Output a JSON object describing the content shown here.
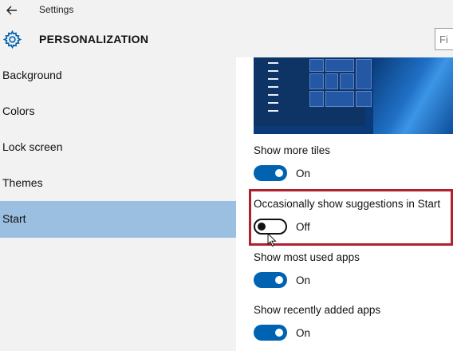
{
  "window": {
    "title": "Settings",
    "back_icon": "back-arrow-icon"
  },
  "header": {
    "title": "PERSONALIZATION",
    "icon": "gear-icon",
    "search_partial": "Fi"
  },
  "sidebar": {
    "items": [
      {
        "label": "Background",
        "selected": false
      },
      {
        "label": "Colors",
        "selected": false
      },
      {
        "label": "Lock screen",
        "selected": false
      },
      {
        "label": "Themes",
        "selected": false
      },
      {
        "label": "Start",
        "selected": true
      }
    ],
    "selected_color": "#9bbfe0"
  },
  "settings": [
    {
      "label": "Show more tiles",
      "state": "On"
    },
    {
      "label": "Occasionally show suggestions in Start",
      "state": "Off"
    },
    {
      "label": "Show most used apps",
      "state": "On"
    },
    {
      "label": "Show recently added apps",
      "state": "On"
    }
  ],
  "colors": {
    "accent": "#0063b1",
    "highlight_border": "#b0202d"
  }
}
